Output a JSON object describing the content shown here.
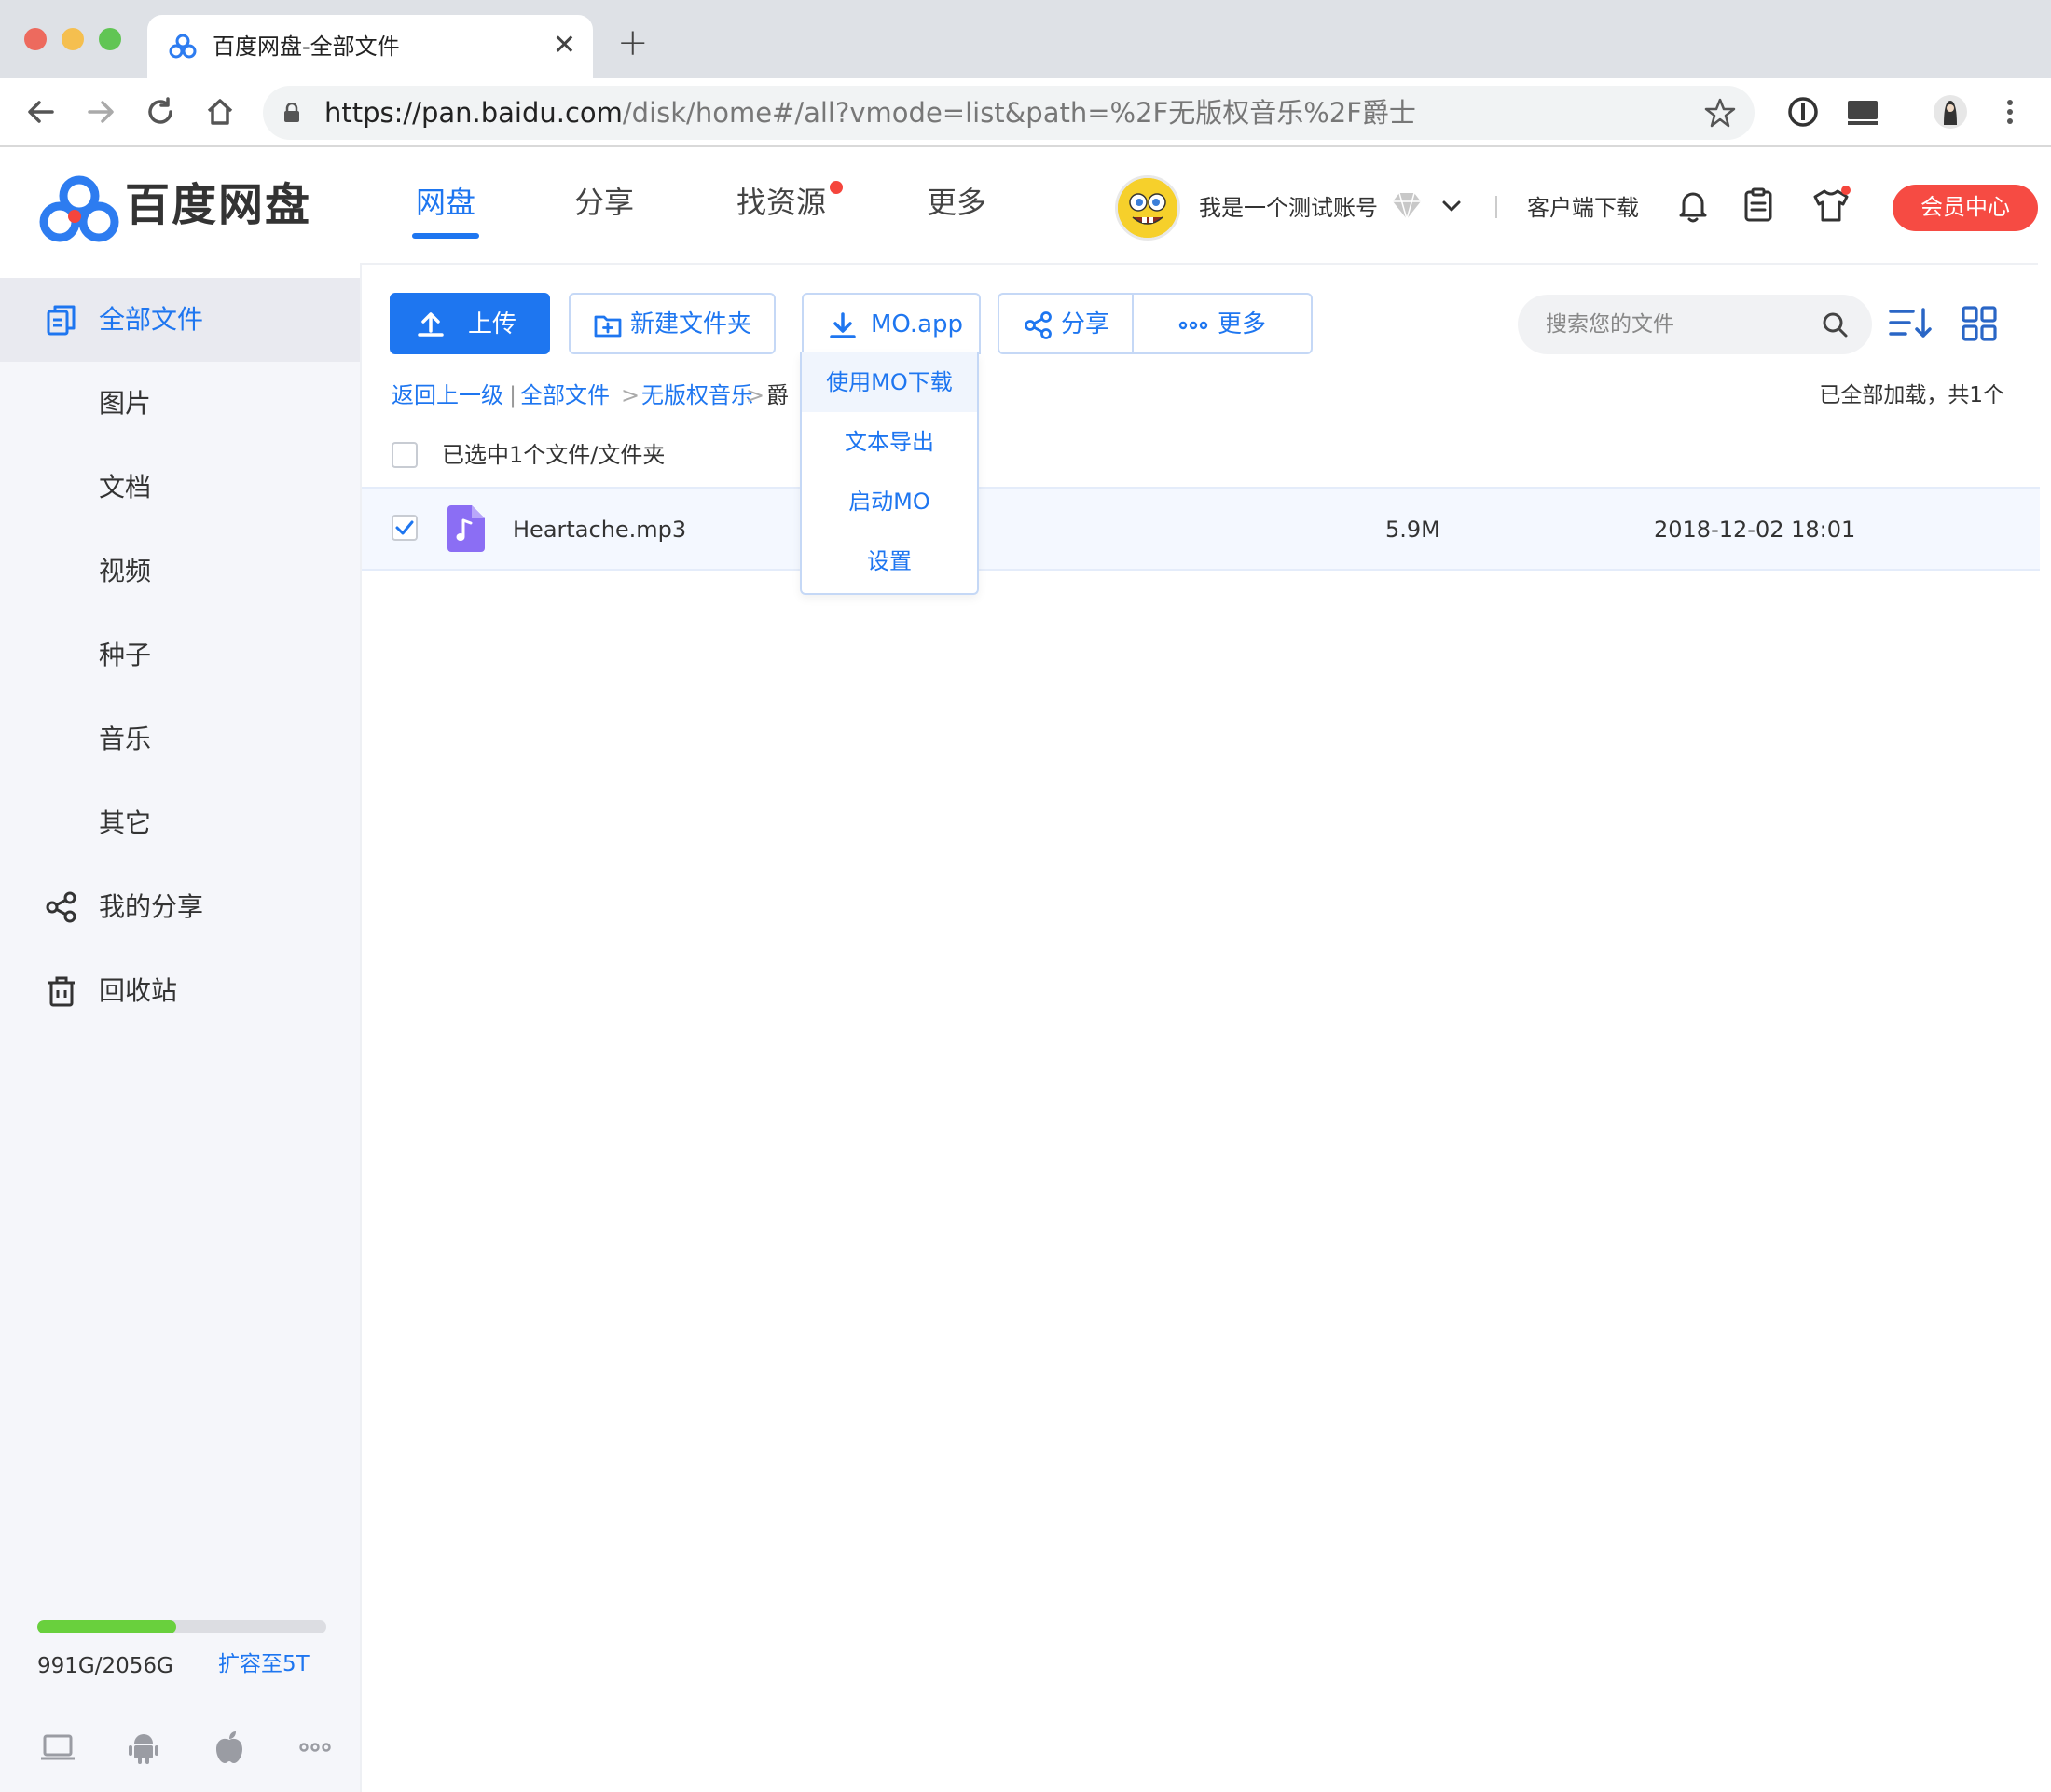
{
  "browser": {
    "tab_title": "百度网盘-全部文件",
    "tab_close": "✕",
    "new_tab": "+",
    "url_host": "https://pan.baidu.com",
    "url_path": "/disk/home#/all?vmode=list&path=%2F无版权音乐%2F爵士"
  },
  "header": {
    "logo_text": "百度网盘",
    "nav": [
      {
        "label": "网盘",
        "active": true
      },
      {
        "label": "分享",
        "active": false
      },
      {
        "label": "找资源",
        "active": false,
        "badge": true
      },
      {
        "label": "更多",
        "active": false
      }
    ],
    "username": "我是一个测试账号",
    "client_download": "客户端下载",
    "vip_center": "会员中心",
    "accent": "#1e76f0",
    "vip_color": "#f64b43"
  },
  "sidebar": {
    "items": [
      {
        "label": "全部文件",
        "icon": "files-icon",
        "active": true
      },
      {
        "label": "图片"
      },
      {
        "label": "文档"
      },
      {
        "label": "视频"
      },
      {
        "label": "种子"
      },
      {
        "label": "音乐"
      },
      {
        "label": "其它"
      },
      {
        "label": "我的分享",
        "icon": "share-icon"
      },
      {
        "label": "回收站",
        "icon": "trash-icon"
      }
    ],
    "quota": {
      "text": "991G/2056G",
      "used_fraction": 0.48,
      "expand_label": "扩容至5T"
    },
    "platforms": [
      "desktop-icon",
      "android-icon",
      "apple-icon",
      "more-icon"
    ]
  },
  "toolbar": {
    "upload": "上传",
    "new_folder": "新建文件夹",
    "mo_app": "MO.app",
    "share": "分享",
    "more": "更多",
    "search_placeholder": "搜索您的文件"
  },
  "breadcrumb": {
    "back": "返回上一级",
    "items": [
      "全部文件",
      "无版权音乐"
    ],
    "current": "爵",
    "sep": ">"
  },
  "status": {
    "loaded": "已全部加载，共1个",
    "selected": "已选中1个文件/文件夹"
  },
  "files": [
    {
      "name": "Heartache.mp3",
      "size": "5.9M",
      "date": "2018-12-02 18:01",
      "checked": true
    }
  ],
  "dropdown": {
    "items": [
      "使用MO下载",
      "文本导出",
      "启动MO",
      "设置"
    ]
  }
}
